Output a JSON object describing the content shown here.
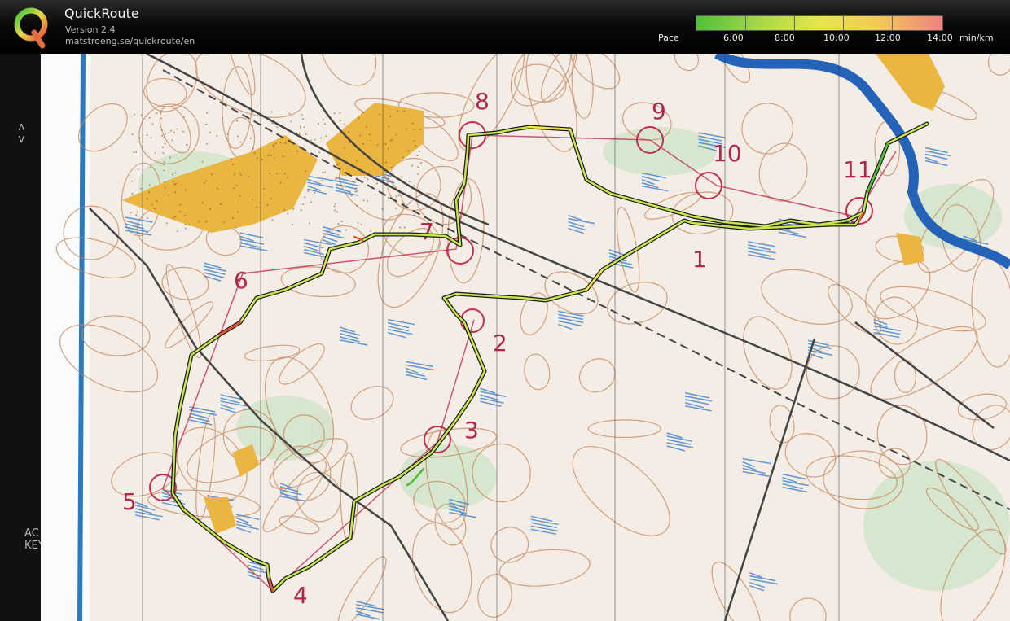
{
  "app": {
    "title": "QuickRoute",
    "version": "Version 2.4",
    "url": "matstroeng.se/quickroute/en"
  },
  "pace_legend": {
    "label": "Pace",
    "ticks": [
      "6:00",
      "8:00",
      "10:00",
      "12:00",
      "14:00"
    ],
    "unit": "min/km",
    "colors": [
      "#4fbf3a",
      "#a6d64a",
      "#e6e64a",
      "#f2c85a",
      "#f08080"
    ]
  },
  "map": {
    "control_labels": [
      "1",
      "2",
      "3",
      "4",
      "5",
      "6",
      "7",
      "8",
      "9",
      "10",
      "11"
    ]
  },
  "left_strip": {
    "marks": [
      "< >",
      "AC",
      "KEY"
    ]
  }
}
